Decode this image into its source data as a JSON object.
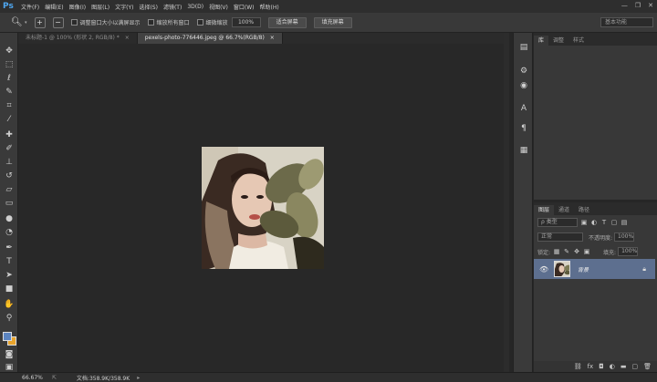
{
  "app": {
    "logo": "Ps"
  },
  "menu": [
    "文件(F)",
    "编辑(E)",
    "图像(I)",
    "图层(L)",
    "文字(Y)",
    "选择(S)",
    "滤镜(T)",
    "3D(D)",
    "视图(V)",
    "窗口(W)",
    "帮助(H)"
  ],
  "window_buttons": {
    "minimize": "—",
    "restore": "❐",
    "close": "✕"
  },
  "options": {
    "tool_icon": "zoom-icon",
    "resize_windows_label": "调整窗口大小以满屏显示",
    "zoom_all_label": "缩放所有窗口",
    "scrubby_zoom_label": "细微缩放",
    "zoom_value": "100%",
    "fit_screen_label": "适合屏幕",
    "fill_screen_label": "填充屏幕",
    "workspace": "基本功能"
  },
  "tabs": [
    {
      "label": "未标题-1 @ 100% (形状 2, RGB/8) *",
      "close": "×"
    },
    {
      "label": "pexels-photo-776446.jpeg @ 66.7%(RGB/8)",
      "close": "×"
    }
  ],
  "tools": [
    "move-icon",
    "marquee-icon",
    "lasso-icon",
    "quick-select-icon",
    "crop-icon",
    "eyedropper-icon",
    "healing-icon",
    "brush-icon",
    "stamp-icon",
    "history-brush-icon",
    "eraser-icon",
    "gradient-icon",
    "blur-icon",
    "dodge-icon",
    "pen-icon",
    "type-icon",
    "path-select-icon",
    "shape-icon",
    "hand-icon",
    "zoom-icon"
  ],
  "top_panel_tabs": [
    "库",
    "调整",
    "样式"
  ],
  "layers_panel": {
    "tabs": [
      "图层",
      "通道",
      "路径"
    ],
    "filter_label": "ρ 类型",
    "blend_mode": "正常",
    "opacity_label": "不透明度:",
    "opacity_value": "100%",
    "lock_label": "锁定:",
    "fill_label": "填充:",
    "fill_value": "100%",
    "layer_name": "背景"
  },
  "status": {
    "zoom": "66.67%",
    "doc": "文档:358.9K/358.9K",
    "arrow": "▸"
  },
  "colors": {
    "foreground": "#5b84c0",
    "background": "#e8a42c",
    "selected_layer": "#5d6f8f"
  }
}
